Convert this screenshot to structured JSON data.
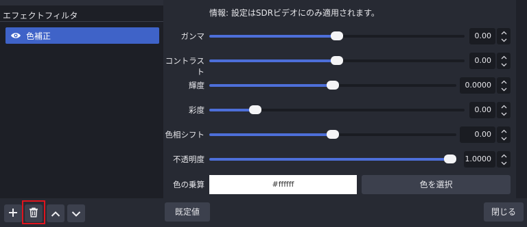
{
  "filters_panel": {
    "title": "エフェクトフィルタ",
    "items": [
      {
        "label": "色補正",
        "visible": true
      }
    ],
    "toolbar": {
      "add_icon": "plus-icon",
      "remove_icon": "trash-icon",
      "move_up_icon": "chevron-up-icon",
      "move_down_icon": "chevron-down-icon"
    }
  },
  "properties": {
    "info": "情報: 設定はSDRビデオにのみ適用されます。",
    "gamma": {
      "label": "ガンマ",
      "value": "0.00",
      "level": 0.5
    },
    "contrast": {
      "label": "コントラスト",
      "value": "0.00",
      "level": 0.5
    },
    "brightness": {
      "label": "輝度",
      "value": "0.0000",
      "level": 0.5
    },
    "saturation": {
      "label": "彩度",
      "value": "0.00",
      "level": 0.18
    },
    "hue_shift": {
      "label": "色相シフト",
      "value": "0.00",
      "level": 0.5
    },
    "opacity": {
      "label": "不透明度",
      "value": "1.0000",
      "level": 1.0
    },
    "color_multiply": {
      "label": "色の乗算",
      "value": "#ffffff",
      "select_button": "色を選択"
    }
  },
  "footer": {
    "defaults_button": "既定値",
    "close_button": "閉じる"
  },
  "colors": {
    "accent": "#4d6fd9",
    "selected_item": "#3f63c8",
    "highlight_box": "#e0141e"
  }
}
